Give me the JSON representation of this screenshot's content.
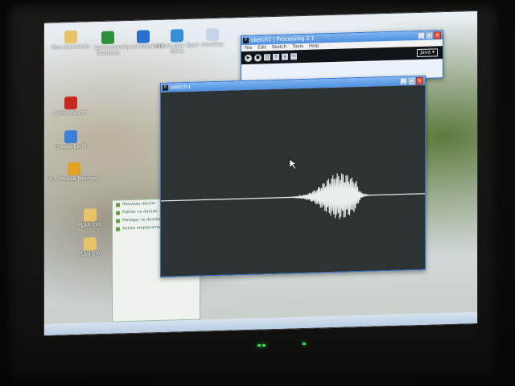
{
  "desktop_icons": [
    {
      "label": "Mes documents",
      "color": "#e8c36a"
    },
    {
      "label": "Connexions Samsung",
      "color": "#2c8f3c"
    },
    {
      "label": "Favoris Bluetooth",
      "color": "#2d6fd0"
    },
    {
      "label": "Favoris pour Ajout tâche",
      "color": "#3a8ed6"
    },
    {
      "label": "IrfanView",
      "color": "#c6d6ea"
    },
    {
      "label": "Adobe Reader",
      "color": "#c8291f"
    },
    {
      "label": "Google Earth",
      "color": "#3d7fd8"
    },
    {
      "label": "A.C. Mobile Manager",
      "color": "#e0a321"
    },
    {
      "label": "PLAN CVC",
      "color": "#e8c36a"
    },
    {
      "label": "PLAN CVC",
      "color": "#e8c36a"
    }
  ],
  "processing_window": {
    "title": "sketch1 | Processing 2.1",
    "menu": [
      "File",
      "Edit",
      "Sketch",
      "Tools",
      "Help"
    ],
    "toolbar_icons": [
      "run-icon",
      "stop-icon",
      "new-icon",
      "open-icon",
      "save-icon",
      "export-icon"
    ],
    "mode": "Java ▾"
  },
  "sketch_window": {
    "title": "sketch1",
    "bg": "#2d3235",
    "waveform_color": "#e9eef0",
    "waveform": {
      "x_start": 0.0,
      "x_end": 1.0,
      "burst_center": 0.68,
      "burst_width": 0.22,
      "peak_amplitude": 0.09
    }
  },
  "side_panel": {
    "items": [
      "Nouveau dossier",
      "Publier ce dossier",
      "Partager ce dossier",
      "Autres emplacements"
    ]
  }
}
